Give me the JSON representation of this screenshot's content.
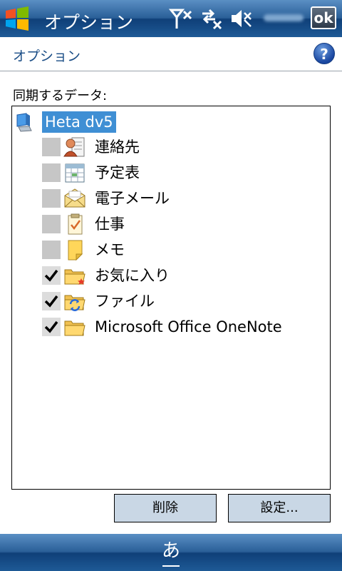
{
  "titlebar": {
    "title": "オプション",
    "ok_label": "ok",
    "icons": [
      "start-icon",
      "signal-off-icon",
      "data-off-icon",
      "volume-muted-icon"
    ]
  },
  "header": {
    "title": "オプション",
    "help_label": "?"
  },
  "content": {
    "list_label": "同期するデータ:",
    "root": {
      "label": "Heta dv5",
      "icon": "desktop-pc-icon",
      "selected": true
    },
    "items": [
      {
        "label": "連絡先",
        "checked": false,
        "icon": "contacts-icon"
      },
      {
        "label": "予定表",
        "checked": false,
        "icon": "calendar-icon"
      },
      {
        "label": "電子メール",
        "checked": false,
        "icon": "email-icon"
      },
      {
        "label": "仕事",
        "checked": false,
        "icon": "tasks-icon"
      },
      {
        "label": "メモ",
        "checked": false,
        "icon": "notes-icon"
      },
      {
        "label": "お気に入り",
        "checked": true,
        "icon": "favorites-folder-icon"
      },
      {
        "label": "ファイル",
        "checked": true,
        "icon": "sync-files-folder-icon"
      },
      {
        "label": "Microsoft Office OneNote",
        "checked": true,
        "icon": "folder-icon"
      }
    ]
  },
  "buttons": {
    "delete_label": "削除",
    "settings_label": "設定..."
  },
  "bottombar": {
    "ime_label": "あ"
  }
}
